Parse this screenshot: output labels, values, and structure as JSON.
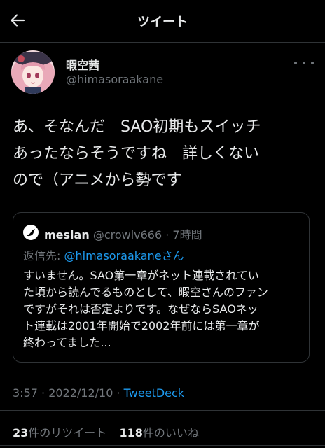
{
  "header": {
    "title": "ツイート",
    "back_icon": "arrow-left-icon"
  },
  "author": {
    "display_name": "暇空茜",
    "handle": "@himasoraakane"
  },
  "tweet": {
    "lines": [
      "あ、そなんだ　SAO初期もスイッチ",
      "あったならそうですね　詳しくない",
      "ので（アニメから勢です"
    ]
  },
  "quoted_tweet": {
    "name": "mesian",
    "handle_time": "@crowlv666 · 7時間",
    "reply_label": "返信先: ",
    "reply_handle": "@himasoraakaneさん",
    "lines": [
      "すいません。SAO第一章がネット連載されてい",
      "た頃から読んでるものとして、暇空さんのファン",
      "ですがそれは否定よりです。なぜならSAOネッ",
      "ト連載は2001年開始で2002年前には第一章が",
      "終わってました..."
    ]
  },
  "meta": {
    "time_date": "3:57 · 2022/12/10 · ",
    "source": "TweetDeck"
  },
  "stats": {
    "retweets_count": "23",
    "retweets_label": "件のリツイート",
    "likes_count": "118",
    "likes_label": "件のいいね"
  },
  "colors": {
    "background": "#000000",
    "text": "#e7e9ea",
    "secondary": "#71767b",
    "link": "#1d9bf0",
    "border": "#2f3336"
  }
}
